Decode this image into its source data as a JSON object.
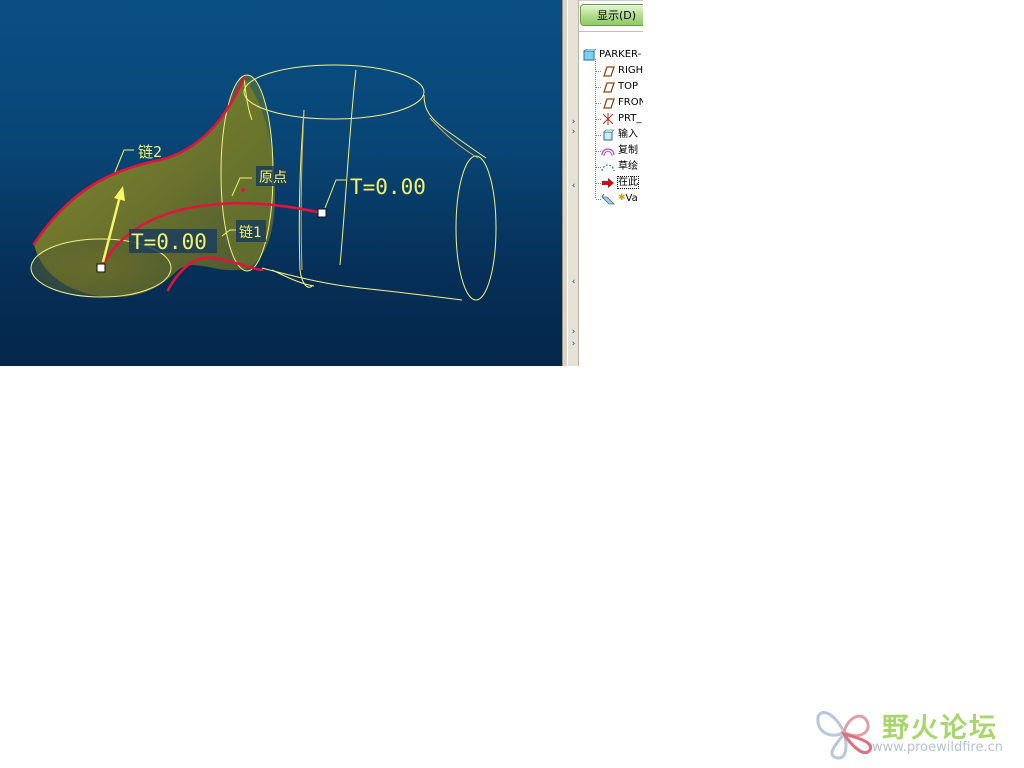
{
  "viewport": {
    "labels": {
      "chain2": "链2",
      "origin": "原点",
      "chain1": "链1",
      "t_left": "T=0.00",
      "t_right": "T=0.00"
    },
    "colors": {
      "background_top": "#0a4f85",
      "background_bottom": "#04264a",
      "chain_curve": "#e0143c",
      "surface_fill": "#8a8a20",
      "wireframe": "#f2f285",
      "label_text": "#f3f36a"
    }
  },
  "sidebar": {
    "show_button": "显示(D)",
    "tree_items": [
      {
        "label": "PARKER-",
        "icon": "part-icon"
      },
      {
        "label": "RIGH",
        "icon": "datum-plane-icon"
      },
      {
        "label": "TOP",
        "icon": "datum-plane-icon"
      },
      {
        "label": "FRON",
        "icon": "datum-plane-icon"
      },
      {
        "label": "PRT_",
        "icon": "coordinate-system-icon"
      },
      {
        "label": "输入",
        "icon": "import-feature-icon"
      },
      {
        "label": "复制",
        "icon": "copy-surface-icon"
      },
      {
        "label": "草绘",
        "icon": "sketch-icon"
      },
      {
        "label": "在此",
        "icon": "insert-here-arrow-icon"
      },
      {
        "label": "Va",
        "icon": "variable-section-sweep-icon"
      }
    ]
  },
  "watermark": {
    "title": "野火论坛",
    "url": "www.proewildfire.cn"
  }
}
